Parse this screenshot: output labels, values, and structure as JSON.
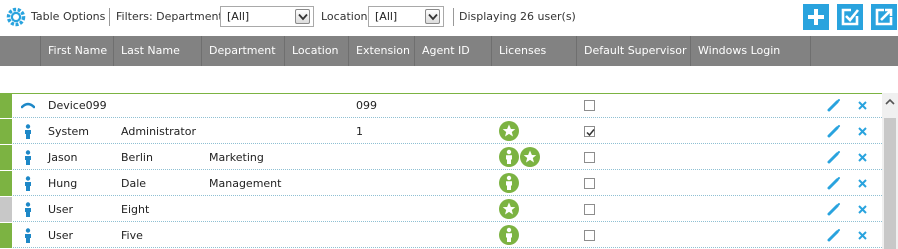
{
  "toolbar": {
    "table_options_label": "Table Options",
    "filters_label": "Filters: Department",
    "department_select": {
      "value": "[All]"
    },
    "location_label": "Location",
    "location_select": {
      "value": "[All]"
    },
    "displaying_text": "Displaying 26 user(s)",
    "buttons": [
      "add-icon",
      "edit-check-icon",
      "export-icon"
    ]
  },
  "columns": [
    "First Name",
    "Last Name",
    "Department",
    "Location",
    "Extension",
    "Agent ID",
    "Licenses",
    "Default Supervisor",
    "Windows Login"
  ],
  "rows": [
    {
      "type": "device",
      "first_name": "Device099",
      "last_name": "",
      "department": "",
      "extension": "099",
      "licenses": [],
      "default_supervisor": false
    },
    {
      "type": "user",
      "first_name": "System",
      "last_name": "Administrator",
      "department": "",
      "extension": "1",
      "licenses": [
        "star"
      ],
      "default_supervisor": true
    },
    {
      "type": "user",
      "first_name": "Jason",
      "last_name": "Berlin",
      "department": "Marketing",
      "extension": "",
      "licenses": [
        "person",
        "star"
      ],
      "default_supervisor": false
    },
    {
      "type": "user",
      "first_name": "Hung",
      "last_name": "Dale",
      "department": "Management",
      "extension": "",
      "licenses": [
        "person"
      ],
      "default_supervisor": false
    },
    {
      "type": "user",
      "first_name": "User",
      "last_name": "Eight",
      "department": "",
      "extension": "",
      "licenses": [
        "star"
      ],
      "default_supervisor": false
    },
    {
      "type": "user",
      "first_name": "User",
      "last_name": "Five",
      "department": "",
      "extension": "",
      "licenses": [
        "person"
      ],
      "default_supervisor": false
    }
  ],
  "colors": {
    "accent_green": "#7cb342",
    "accent_gray": "#c8c8c8",
    "header_gray": "#828282",
    "brand_blue": "#29a3de",
    "license_green": "#7cb342"
  }
}
